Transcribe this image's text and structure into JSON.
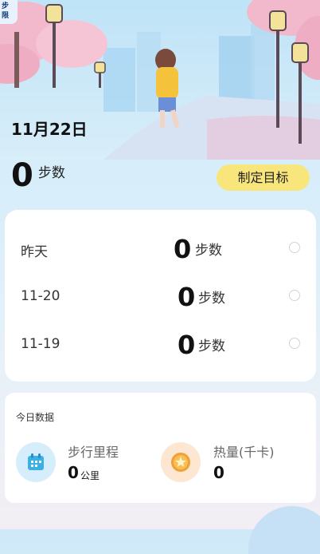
{
  "badge": {
    "line1": "步",
    "line2": "限"
  },
  "header": {
    "date": "11月22日",
    "today_steps": "0",
    "steps_unit": "步数",
    "goal_button": "制定目标"
  },
  "history": [
    {
      "label": "昨天",
      "steps": "0",
      "unit": "步数"
    },
    {
      "label": "11-20",
      "steps": "0",
      "unit": "步数"
    },
    {
      "label": "11-19",
      "steps": "0",
      "unit": "步数"
    }
  ],
  "stats": {
    "title": "今日数据",
    "distance": {
      "label": "步行里程",
      "value": "0",
      "unit": "公里",
      "icon": "calendar-icon"
    },
    "calories": {
      "label": "热量(千卡)",
      "value": "0",
      "icon": "star-coin-icon"
    }
  },
  "colors": {
    "goal_button": "#f8e67c",
    "card": "#ffffff",
    "distance_icon": "#3ab0e8",
    "calorie_icon": "#f0a035"
  }
}
